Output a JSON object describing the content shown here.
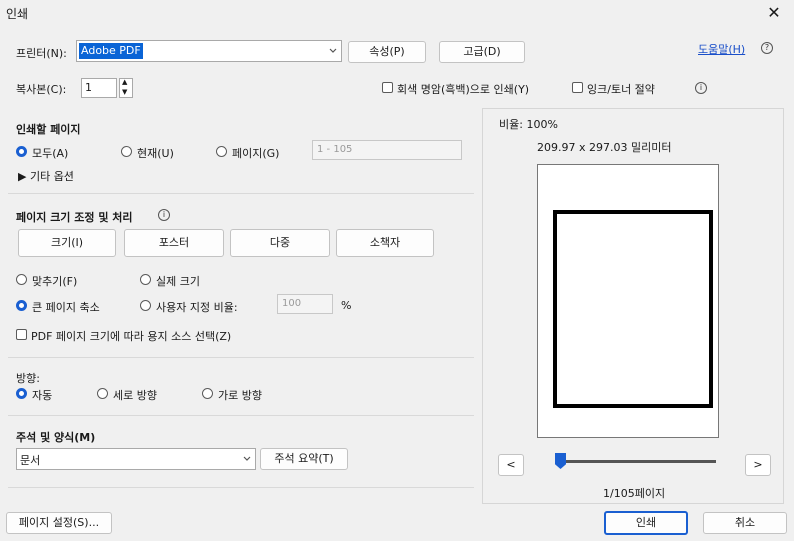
{
  "window": {
    "title": "인쇄",
    "close": "✕"
  },
  "printer": {
    "label": "프린터(N):",
    "value": "Adobe PDF",
    "properties_button": "속성(P)",
    "advanced_button": "고급(D)",
    "help_link": "도움말(H)",
    "help_icon": "?"
  },
  "copies": {
    "label": "복사본(C):",
    "value": "1",
    "grayscale_label": "회색 명암(흑백)으로 인쇄(Y)",
    "save_ink_label": "잉크/토너 절약",
    "info_icon": "i"
  },
  "pages_to_print": {
    "title": "인쇄할 페이지",
    "all_label": "모두(A)",
    "current_label": "현재(U)",
    "pages_label": "페이지(G)",
    "pages_value": "1 - 105",
    "more_options": "▶ 기타 옵션"
  },
  "sizing": {
    "title": "페이지 크기 조정 및 처리",
    "info_icon": "i",
    "size_button": "크기(I)",
    "poster_button": "포스터",
    "multiple_button": "다중",
    "booklet_button": "소책자",
    "fit_label": "맞추기(F)",
    "actual_label": "실제 크기",
    "shrink_label": "큰 페이지 축소",
    "custom_label": "사용자 지정 비율:",
    "custom_value": "100",
    "percent": "%",
    "pdf_source_label": "PDF 페이지 크기에 따라 용지 소스 선택(Z)"
  },
  "orientation": {
    "title": "방향:",
    "auto_label": "자동",
    "portrait_label": "세로 방향",
    "landscape_label": "가로 방향"
  },
  "comments": {
    "title": "주석 및 양식(M)",
    "value": "문서",
    "summarize_button": "주석 요약(T)"
  },
  "preview": {
    "scale": "비율: 100%",
    "dimensions": "209.97 x 297.03 밀리미터",
    "prev": "<",
    "next": ">",
    "page_indicator": "1/105페이지"
  },
  "footer": {
    "page_setup_button": "페이지 설정(S)...",
    "print_button": "인쇄",
    "cancel_button": "취소"
  },
  "colors": {
    "accent": "#1a5fd1",
    "selection": "#0a64d6"
  }
}
